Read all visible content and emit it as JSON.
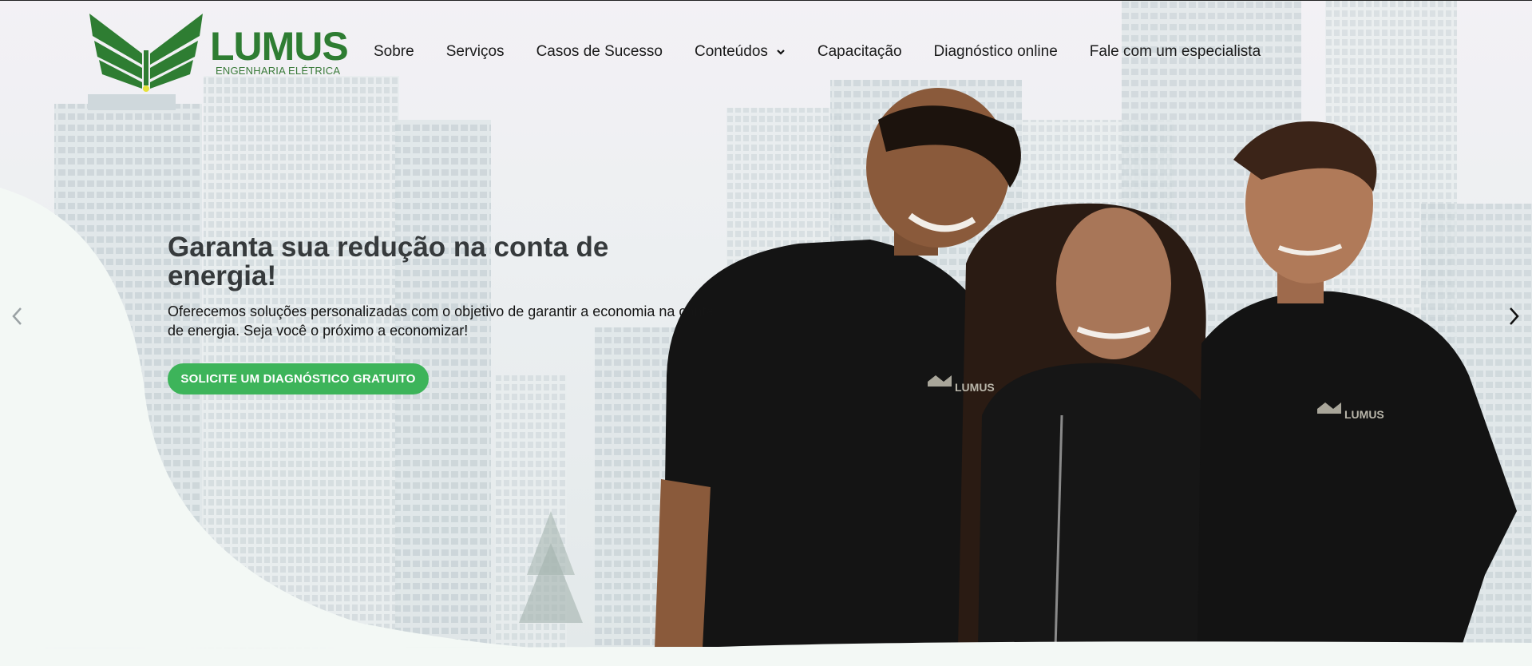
{
  "brand": {
    "name": "LUMUS",
    "tagline": "ENGENHARIA ELÉTRICA",
    "logo_icon": "book-wings-logo-icon",
    "shirt_logo_text": "LUMUS"
  },
  "nav": {
    "items": [
      {
        "label": "Sobre"
      },
      {
        "label": "Serviços"
      },
      {
        "label": "Casos de Sucesso"
      },
      {
        "label": "Conteúdos",
        "icon": "chevron-down-icon"
      },
      {
        "label": "Capacitação"
      },
      {
        "label": "Diagnóstico online"
      },
      {
        "label": "Fale com um especialista"
      }
    ]
  },
  "hero": {
    "headline": "Garanta sua redução na conta de energia!",
    "subtitle": "Oferecemos soluções personalizadas com o objetivo de garantir a economia na conta de energia. Seja você o próximo a economizar!",
    "cta_label": "SOLICITE UM DIAGNÓSTICO GRATUITO",
    "prev_icon": "chevron-left-icon",
    "next_icon": "chevron-right-icon"
  },
  "colors": {
    "brand_green": "#2e7d32",
    "cta_green": "#3db45a",
    "headline": "#363a3c"
  }
}
